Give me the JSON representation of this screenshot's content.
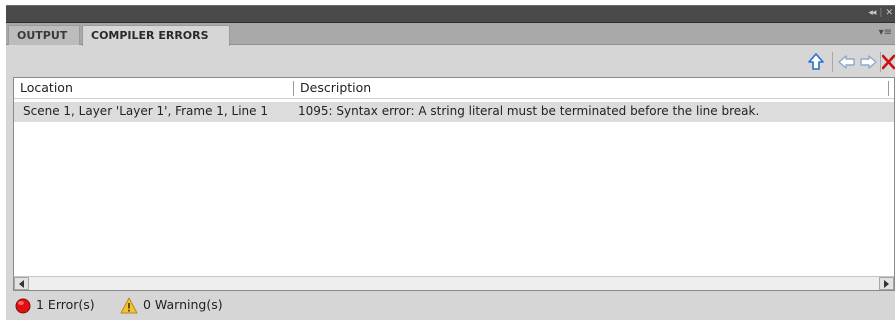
{
  "tabs": [
    {
      "label": "OUTPUT",
      "active": false
    },
    {
      "label": "COMPILER ERRORS",
      "active": true
    }
  ],
  "toolbar": {
    "icons": [
      "go-to-source-icon",
      "previous-icon",
      "next-icon",
      "clear-icon"
    ]
  },
  "table": {
    "columns": [
      "Location",
      "Description"
    ],
    "rows": [
      {
        "location": "Scene 1, Layer 'Layer 1', Frame 1, Line 1",
        "description": "1095: Syntax error: A string literal must be terminated before the line break."
      }
    ]
  },
  "status": {
    "errors": "1 Error(s)",
    "warnings": "0 Warning(s)"
  },
  "colors": {
    "error": "#e01010",
    "warning": "#f2c23a",
    "toolbar_icon": "#2a6fc9",
    "clear": "#cc1010"
  }
}
